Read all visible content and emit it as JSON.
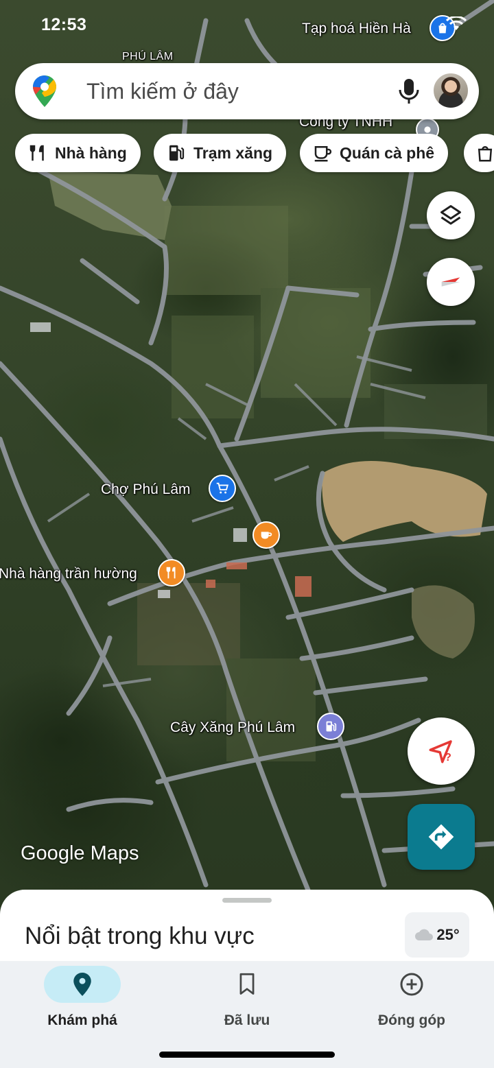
{
  "status_bar": {
    "time": "12:53"
  },
  "search": {
    "placeholder": "Tìm kiếm ở đây"
  },
  "chips": [
    {
      "label": "Nhà hàng",
      "icon": "restaurant-icon"
    },
    {
      "label": "Trạm xăng",
      "icon": "gas-station-icon"
    },
    {
      "label": "Quán cà phê",
      "icon": "coffee-icon"
    }
  ],
  "map": {
    "labels": {
      "phu_lam_area": "PHÚ LÂM",
      "tap_hoa": "Tạp hoá Hiền Hà",
      "cong_ty": "Công ty TNHH",
      "cho_phu_lam": "Chợ Phú Lâm",
      "nha_hang": "Nhà hàng trần hường",
      "cay_xang": "Cây Xăng Phú Lâm"
    },
    "logo": "Google Maps",
    "colors": {
      "market_pin": "#1a73e8",
      "food_pin": "#f28b24",
      "gas_pin": "#7b7fd6",
      "directions_button": "#0b7b8f",
      "road": "#8f959a"
    }
  },
  "bottom_sheet": {
    "title": "Nổi bật trong khu vực",
    "weather": "25°"
  },
  "nav": {
    "items": [
      {
        "label": "Khám phá",
        "icon": "explore-pin-icon",
        "active": true
      },
      {
        "label": "Đã lưu",
        "icon": "bookmark-icon",
        "active": false
      },
      {
        "label": "Đóng góp",
        "icon": "add-circle-icon",
        "active": false
      }
    ]
  }
}
